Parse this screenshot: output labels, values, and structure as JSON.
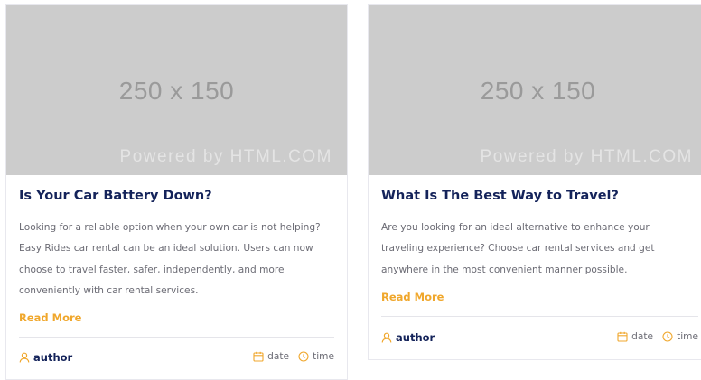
{
  "theme": {
    "accent": "#f0a72c",
    "title_color": "#14235a",
    "text_color": "#6b6b74",
    "placeholder_bg": "#cccccc"
  },
  "posts": [
    {
      "thumb_size": "250 x 150",
      "thumb_powered": "Powered by HTML.COM",
      "title": "Is Your Car Battery Down?",
      "excerpt": "Looking for a reliable option when your own car is not helping? Easy Rides car rental can be an ideal solution. Users can now choose to travel faster, safer, independently, and more conveniently with car rental services.",
      "read_more": "Read More",
      "author_icon": "user-icon",
      "author": "author",
      "date_icon": "calendar-icon",
      "date": "date",
      "time_icon": "clock-icon",
      "time": "time"
    },
    {
      "thumb_size": "250 x 150",
      "thumb_powered": "Powered by HTML.COM",
      "title": "What Is The Best Way to Travel?",
      "excerpt": "Are you looking for an ideal alternative to enhance your traveling experience? Choose car rental services and get anywhere in the most convenient manner possible.",
      "read_more": "Read More",
      "author_icon": "user-icon",
      "author": "author",
      "date_icon": "calendar-icon",
      "date": "date",
      "time_icon": "clock-icon",
      "time": "time"
    }
  ]
}
